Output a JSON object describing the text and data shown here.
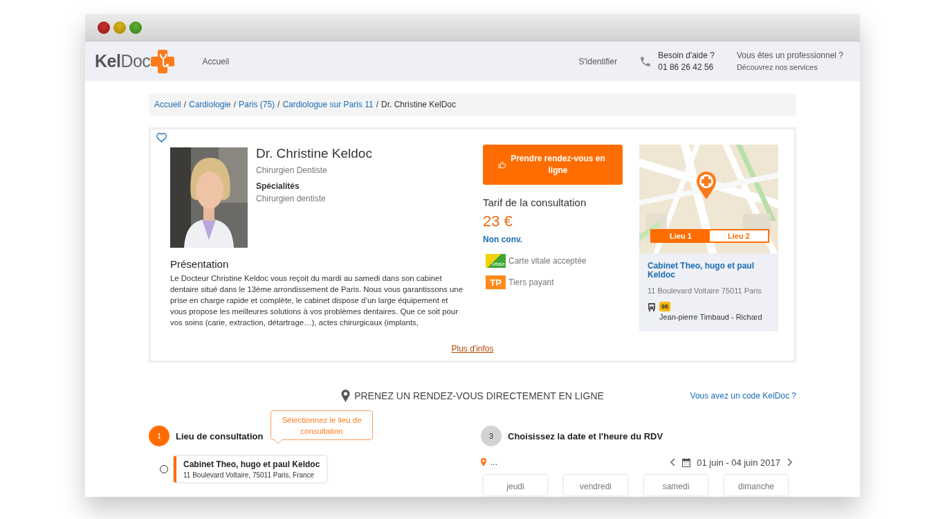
{
  "navbar": {
    "logo": "**Kel**Doc",
    "links": [
      {
        "label": "Accueil"
      }
    ],
    "login": "S'identifier",
    "help": {
      "title": "Besoin d'aide ?",
      "phone": "01 86 26 42 56"
    },
    "pro": {
      "title": "Vous êtes un professionnel ?",
      "subtitle": "Découvrez nos services"
    }
  },
  "breadcrumb": [
    {
      "label": "Accueil",
      "link": true
    },
    {
      "separator": "/",
      "label": "Cardiologie",
      "link": true
    },
    {
      "separator": "/",
      "label": "Paris (75)",
      "link": true
    },
    {
      "separator": "/",
      "label": "Cardiologue sur Paris 11",
      "link": true
    },
    {
      "separator": "/",
      "label": "Dr. Christine KelDoc",
      "link": false
    }
  ],
  "profile": {
    "favorite": false,
    "name": "Dr. Christine Keldoc",
    "title": "Chirurgien Dentiste",
    "specialties_label": "Spécialités",
    "specialty": "Chirurgien dentiste",
    "presentation_title": "Présentation",
    "presentation": "Le Docteur Christine Keldoc vous reçoit du mardi au samedi dans son cabinet dentaire situé dans le 13ème arrondissement de Paris. Nous vous garantissons une prise en charge rapide et complète, le cabinet dispose d’un large équipement et vous propose les meilleures solutions à vos problèmes dentaires. Que ce soit pour vos soins (carie, extraction, détartrage…), actes chirurgicaux (implants,",
    "more_link": "Plus d'infos",
    "booking_button": "Prendre rendez-vous en ligne",
    "fee_label": "Tarif de la consultation",
    "fee": "23 €",
    "convention": "Non conv.",
    "benefits": [
      {
        "kind": "vitale",
        "badge": "vitale",
        "label": "Carte vitale acceptée"
      },
      {
        "kind": "tp",
        "badge": "TP",
        "label": "Tiers payant"
      }
    ]
  },
  "map": {
    "tabs": [
      {
        "label": "Lieu 1",
        "selected": true
      },
      {
        "label": "Lieu 2",
        "selected": false
      }
    ],
    "location": {
      "name": "Cabinet Theo, hugo et paul Keldoc",
      "address": "11 Boulevard Voltaire 75011 Paris",
      "bus_line": "96",
      "stop": "Jean-pierre Timbaud - Richard"
    }
  },
  "booking": {
    "heading": "PRENEZ UN RENDEZ-VOUS DIRECTEMENT EN LIGNE",
    "code_link": "Vous avez un code KelDoc ?",
    "steps": [
      {
        "kind": "place",
        "number": "1",
        "title": "Lieu de consultation",
        "active": true,
        "tooltip": "Sélectionnez le lieu de consultation",
        "places": [
          {
            "name": "Cabinet Theo, hugo et paul Keldoc",
            "address": "11 Boulevard Voltaire, 75011 Paris, France",
            "selected": false
          }
        ]
      },
      {
        "kind": "date",
        "number": "3",
        "title": "Choisissez la date et l'heure du RDV",
        "active": false,
        "location": "...",
        "date_range": "01 juin - 04 juin 2017",
        "days": [
          "jeudi",
          "vendredi",
          "samedi",
          "dimanche"
        ]
      }
    ]
  }
}
